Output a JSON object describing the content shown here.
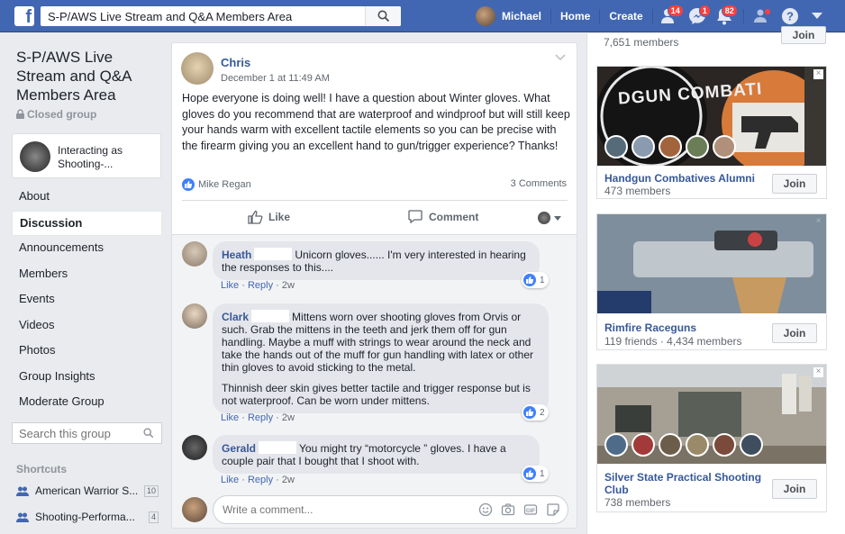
{
  "topbar": {
    "search_value": "S-P/AWS Live Stream and Q&A Members Area",
    "user_name": "Michael",
    "home_label": "Home",
    "create_label": "Create",
    "friends_badge": "14",
    "messages_badge": "1",
    "notifications_badge": "82"
  },
  "group": {
    "title": "S-P/AWS Live Stream and Q&A Members Area",
    "privacy": "Closed group",
    "interacting_as": "Interacting as Shooting-..."
  },
  "sidebar": {
    "items": [
      {
        "label": "About"
      },
      {
        "label": "Discussion"
      },
      {
        "label": "Announcements"
      },
      {
        "label": "Members"
      },
      {
        "label": "Events"
      },
      {
        "label": "Videos"
      },
      {
        "label": "Photos"
      },
      {
        "label": "Group Insights"
      },
      {
        "label": "Moderate Group"
      }
    ],
    "search_placeholder": "Search this group",
    "shortcuts_header": "Shortcuts",
    "shortcuts": [
      {
        "label": "American Warrior S...",
        "count": "10"
      },
      {
        "label": "Shooting-Performa...",
        "count": "4"
      }
    ]
  },
  "post": {
    "author": "Chris",
    "time": "December 1 at 11:49 AM",
    "text": "Hope everyone is doing well! I have a question about Winter gloves. What gloves do you recommend that are waterproof and windproof but will still keep your hands warm with excellent tactile elements so you can be precise with the firearm giving you an excellent hand to gun/trigger experience? Thanks!",
    "reactor": "Mike Regan",
    "comments_count": "3 Comments",
    "like_label": "Like",
    "comment_label": "Comment"
  },
  "comments": [
    {
      "name": "Heath",
      "text": "Unicorn gloves...... I'm very interested in hearing the responses to this....",
      "like": "Like",
      "reply": "Reply",
      "age": "2w",
      "reactions": "1"
    },
    {
      "name": "Clark",
      "text": "Mittens worn over shooting gloves from Orvis or such. Grab the mittens in the teeth and jerk them off for gun handling. Maybe a muff with strings to wear around the neck and take the hands out of the muff for gun handling with latex or other thin gloves to avoid sticking to the metal.",
      "text2": "Thinnish deer skin gives better tactile and trigger response but is not waterproof. Can be worn under mittens.",
      "like": "Like",
      "reply": "Reply",
      "age": "2w",
      "reactions": "2"
    },
    {
      "name": "Gerald",
      "text": "You might try “motorcycle ” gloves. I have a couple pair that I bought that I shoot with.",
      "like": "Like",
      "reply": "Reply",
      "age": "2w",
      "reactions": "1"
    }
  ],
  "write_comment_placeholder": "Write a comment...",
  "suggested": [
    {
      "name": "",
      "members": "7,651 members",
      "join": "Join"
    },
    {
      "name": "Handgun Combatives Alumni",
      "members": "473 members",
      "join": "Join",
      "image_text": "DGUN COMBATI"
    },
    {
      "name": "Rimfire Raceguns",
      "members": "119 friends · 4,434 members",
      "join": "Join"
    },
    {
      "name": "Silver State Practical Shooting Club",
      "members": "738 members",
      "join": "Join"
    }
  ],
  "colors": {
    "brand": "#4267b2",
    "link": "#365899",
    "badge": "#fa3e3e"
  }
}
